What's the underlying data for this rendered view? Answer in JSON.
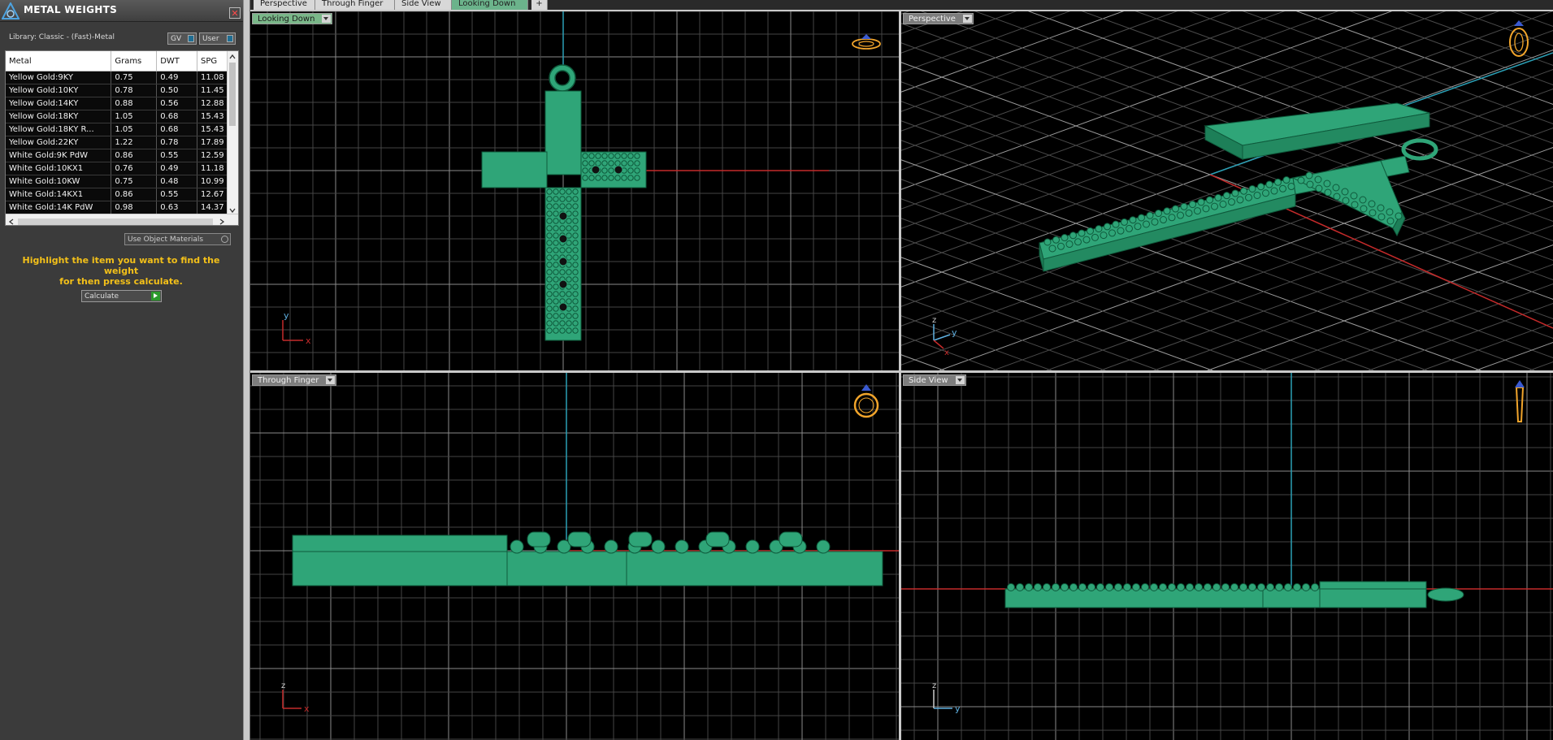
{
  "panel": {
    "title": "METAL WEIGHTS",
    "close_icon": "close-icon",
    "library_label": "Library: Classic - (Fast)-Metal",
    "toggle_gv": "GV",
    "toggle_user": "User",
    "use_object_materials": "Use Object Materials",
    "highlight_msg_line1": "Highlight the item you want to find the weight",
    "highlight_msg_line2": "for then press calculate.",
    "calculate_label": "Calculate",
    "highlight_color": "#f3c019"
  },
  "table": {
    "headers": [
      "Metal",
      "Grams",
      "DWT",
      "SPG"
    ],
    "rows": [
      [
        "Yellow Gold:9KY",
        "0.75",
        "0.49",
        "11.08"
      ],
      [
        "Yellow Gold:10KY",
        "0.78",
        "0.50",
        "11.45"
      ],
      [
        "Yellow Gold:14KY",
        "0.88",
        "0.56",
        "12.88"
      ],
      [
        "Yellow Gold:18KY",
        "1.05",
        "0.68",
        "15.43"
      ],
      [
        "Yellow Gold:18KY R...",
        "1.05",
        "0.68",
        "15.43"
      ],
      [
        "Yellow Gold:22KY",
        "1.22",
        "0.78",
        "17.89"
      ],
      [
        "White Gold:9K PdW",
        "0.86",
        "0.55",
        "12.59"
      ],
      [
        "White Gold:10KX1",
        "0.76",
        "0.49",
        "11.18"
      ],
      [
        "White Gold:10KW",
        "0.75",
        "0.48",
        "10.99"
      ],
      [
        "White Gold:14KX1",
        "0.86",
        "0.55",
        "12.67"
      ],
      [
        "White Gold:14K PdW",
        "0.98",
        "0.63",
        "14.37"
      ]
    ]
  },
  "tabs": [
    {
      "label": "Perspective",
      "active": false
    },
    {
      "label": "Through Finger",
      "active": false
    },
    {
      "label": "Side View",
      "active": false
    },
    {
      "label": "Looking Down",
      "active": true
    }
  ],
  "add_tab_icon": "plus-icon",
  "viewports": {
    "top_left": {
      "label": "Looking Down",
      "axis_a": "y",
      "axis_b": "x",
      "gizmo": "ring-top-icon"
    },
    "top_right": {
      "label": "Perspective",
      "axis_a": "z",
      "axis_b": "y",
      "axis_c": "x",
      "gizmo": "ring-perspective-icon"
    },
    "bottom_left": {
      "label": "Through Finger",
      "axis_a": "z",
      "axis_b": "x",
      "gizmo": "ring-front-icon"
    },
    "bottom_right": {
      "label": "Side View",
      "axis_a": "z",
      "axis_b": "y",
      "gizmo": "ring-side-icon"
    }
  },
  "colors": {
    "model": "#2fa578",
    "model_edge": "#0f5a3c",
    "grid": "#4a4a4a",
    "grid_major": "#8a8a8a",
    "axis_red": "#c42a2a",
    "axis_cyan": "#2b9fb5",
    "gizmo": "#f2a52b"
  }
}
